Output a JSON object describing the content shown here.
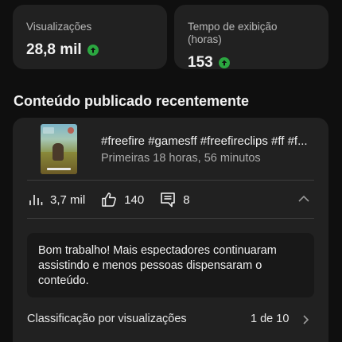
{
  "stats": [
    {
      "label": "Visualizações",
      "value": "28,8 mil",
      "trend": "up",
      "icon": "arrow-up-icon"
    },
    {
      "label": "Tempo de exibição (horas)",
      "value": "153",
      "trend": "up",
      "icon": "arrow-up-icon"
    }
  ],
  "section": {
    "title": "Conteúdo publicado recentemente"
  },
  "video": {
    "title": "#freefire #gamesff #freefireclips #ff #f...",
    "subtitle": "Primeiras 18 horas, 56 minutos",
    "thumbnail_icon": "video-thumbnail"
  },
  "metrics": [
    {
      "icon": "bar-chart-icon",
      "value": "3,7 mil"
    },
    {
      "icon": "thumbs-up-icon",
      "value": "140"
    },
    {
      "icon": "comment-icon",
      "value": "8"
    }
  ],
  "feedback": {
    "text": "Bom trabalho! Mais espectadores continuaram assistindo e menos pessoas dispensaram o conteúdo."
  },
  "ranking": {
    "label": "Classificação por visualizações",
    "value": "1 de 10"
  },
  "colors": {
    "background": "#0f0f0f",
    "card": "#212121",
    "trend_up": "#2ba640",
    "secondary_text": "#aaaaaa"
  }
}
